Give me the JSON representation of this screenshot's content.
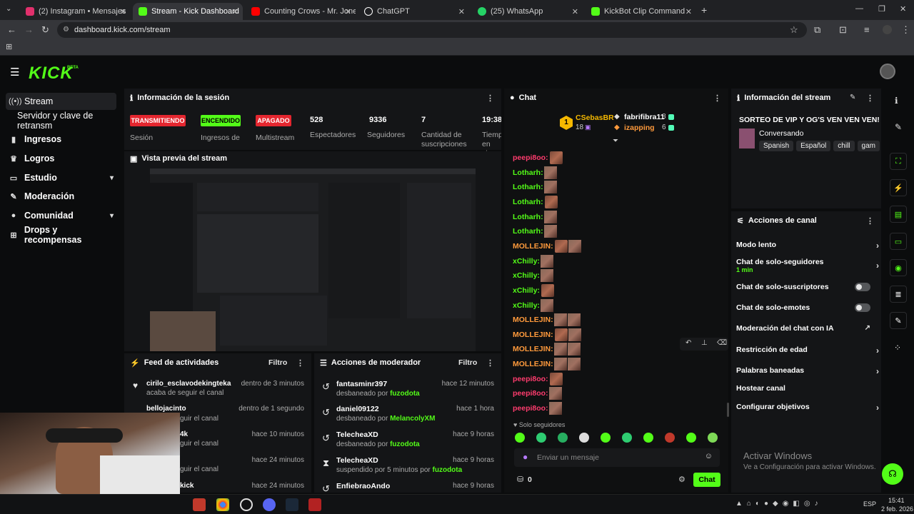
{
  "browser": {
    "tabs": [
      {
        "title": "(2) Instagram • Mensajes",
        "color": "#e1306c"
      },
      {
        "title": "Stream - Kick Dashboard",
        "color": "#53fc18"
      },
      {
        "title": "Counting Crows - Mr. Jones",
        "color": "#ff0000"
      },
      {
        "title": "ChatGPT",
        "color": "#ffffff"
      },
      {
        "title": "(25) WhatsApp",
        "color": "#25d366"
      },
      {
        "title": "KickBot Clip Command",
        "color": "#53fc18"
      }
    ],
    "url": "dashboard.kick.com/stream"
  },
  "header": {
    "logo": "KICK",
    "logo_beta": "BETA"
  },
  "sidebar": {
    "items": [
      {
        "label": "Stream",
        "icon": "broadcast-icon"
      },
      {
        "label": "Servidor y clave de retransm"
      },
      {
        "label": "Ingresos",
        "icon": "chart-icon"
      },
      {
        "label": "Logros",
        "icon": "trophy-icon"
      },
      {
        "label": "Estudio",
        "icon": "studio-icon"
      },
      {
        "label": "Moderación",
        "icon": "wrench-icon"
      },
      {
        "label": "Comunidad",
        "icon": "people-icon"
      },
      {
        "label": "Drops y recompensas",
        "icon": "gift-icon"
      }
    ]
  },
  "session": {
    "title": "Información de la sesión",
    "badges": [
      {
        "text": "TRANSMITIENDO",
        "label": "Sesión"
      },
      {
        "text": "ENCENDIDO",
        "label": "Ingresos de Sesión"
      },
      {
        "text": "APAGADO",
        "label": "Multistream"
      }
    ],
    "stats": [
      {
        "value": "528",
        "label": "Espectadores"
      },
      {
        "value": "9336",
        "label": "Seguidores"
      },
      {
        "value": "7",
        "label": "Cantidad de suscripciones"
      },
      {
        "value": "19:38:",
        "label": "Tiempo en vivo"
      }
    ]
  },
  "preview": {
    "title": "Vista previa del stream"
  },
  "feed": {
    "title": "Feed de actividades",
    "filter": "Filtro",
    "items": [
      {
        "user": "cirilo_esclavodekingteka",
        "action": "acaba de seguir el canal",
        "time": "dentro de 3 minutos"
      },
      {
        "user": "bellojacinto",
        "action": "guir el canal",
        "time": "dentro de 1 segundo"
      },
      {
        "user": "4k",
        "action": "guir el canal",
        "time": "hace 10 minutos"
      },
      {
        "user": "",
        "action": "guir el canal",
        "time": "hace 24 minutos"
      },
      {
        "user": "kick",
        "action": "",
        "time": "hace 24 minutos"
      }
    ]
  },
  "modactions": {
    "title": "Acciones de moderador",
    "filter": "Filtro",
    "items": [
      {
        "user": "fantasminr397",
        "action": "desbaneado por",
        "by": "fuzodota",
        "time": "hace 12 minutos"
      },
      {
        "user": "daniel09122",
        "action": "desbaneado por",
        "by": "MelancolyXM",
        "time": "hace 1 hora"
      },
      {
        "user": "TelecheaXD",
        "action": "desbaneado por",
        "by": "fuzodota",
        "time": "hace 9 horas"
      },
      {
        "user": "TelecheaXD",
        "action": "suspendido por 5 minutos por",
        "by": "fuzodota",
        "time": "hace 9 horas"
      },
      {
        "user": "EnfiebraoAndo",
        "action": "",
        "by": "",
        "time": "hace 9 horas"
      }
    ]
  },
  "chat": {
    "title": "Chat",
    "leaders": [
      {
        "name": "CSebasBR",
        "count": "18"
      },
      {
        "name": "fabrifibra11",
        "count": "8"
      },
      {
        "name": "izapping",
        "count": "6"
      }
    ],
    "rank": "1",
    "messages": [
      {
        "user": "peepi8oo:",
        "color": "#ff3c6e"
      },
      {
        "user": "Lotharh:",
        "color": "#53fc18"
      },
      {
        "user": "Lotharh:",
        "color": "#53fc18"
      },
      {
        "user": "Lotharh:",
        "color": "#53fc18"
      },
      {
        "user": "Lotharh:",
        "color": "#53fc18"
      },
      {
        "user": "Lotharh:",
        "color": "#53fc18"
      },
      {
        "user": "MOLLEJIN:",
        "color": "#ff9a3c"
      },
      {
        "user": "xChilly:",
        "color": "#53fc18"
      },
      {
        "user": "xChilly:",
        "color": "#53fc18"
      },
      {
        "user": "xChilly:",
        "color": "#53fc18"
      },
      {
        "user": "xChilly:",
        "color": "#53fc18"
      },
      {
        "user": "MOLLEJIN:",
        "color": "#ff9a3c"
      },
      {
        "user": "MOLLEJIN:",
        "color": "#ff9a3c"
      },
      {
        "user": "MOLLEJIN:",
        "color": "#ff9a3c"
      },
      {
        "user": "MOLLEJIN:",
        "color": "#ff9a3c"
      },
      {
        "user": "peepi8oo:",
        "color": "#ff3c6e"
      },
      {
        "user": "peepi8oo:",
        "color": "#ff3c6e"
      },
      {
        "user": "peepi8oo:",
        "color": "#ff3c6e"
      }
    ],
    "mode": "Solo seguidores",
    "placeholder": "Enviar un mensaje",
    "points": "0",
    "send": "Chat"
  },
  "streaminfo": {
    "title": "Información del stream",
    "stream_title": "SORTEO DE VIP Y OG'S VEN VEN VEN!",
    "category": "Conversando",
    "tags": [
      "Spanish",
      "Español",
      "chill",
      "gam"
    ]
  },
  "channel_actions": {
    "title": "Acciones de canal",
    "items": [
      {
        "label": "Modo lento",
        "type": "arrow"
      },
      {
        "label": "Chat de solo-seguidores",
        "sub": "1 min",
        "type": "arrow"
      },
      {
        "label": "Chat de solo-suscriptores",
        "type": "toggle"
      },
      {
        "label": "Chat de solo-emotes",
        "type": "toggle"
      },
      {
        "label": "Moderación del chat con IA",
        "type": "external"
      },
      {
        "label": "Restricción de edad",
        "type": "arrow"
      },
      {
        "label": "Palabras baneadas",
        "type": "arrow"
      },
      {
        "label": "Hostear canal",
        "type": "none"
      },
      {
        "label": "Configurar objetivos",
        "type": "arrow"
      }
    ]
  },
  "windows": {
    "activate_title": "Activar Windows",
    "activate_sub": "Ve a Configuración para activar Windows.",
    "clock": "15:41",
    "date": "2 feb. 2026",
    "lang": "ESP"
  }
}
